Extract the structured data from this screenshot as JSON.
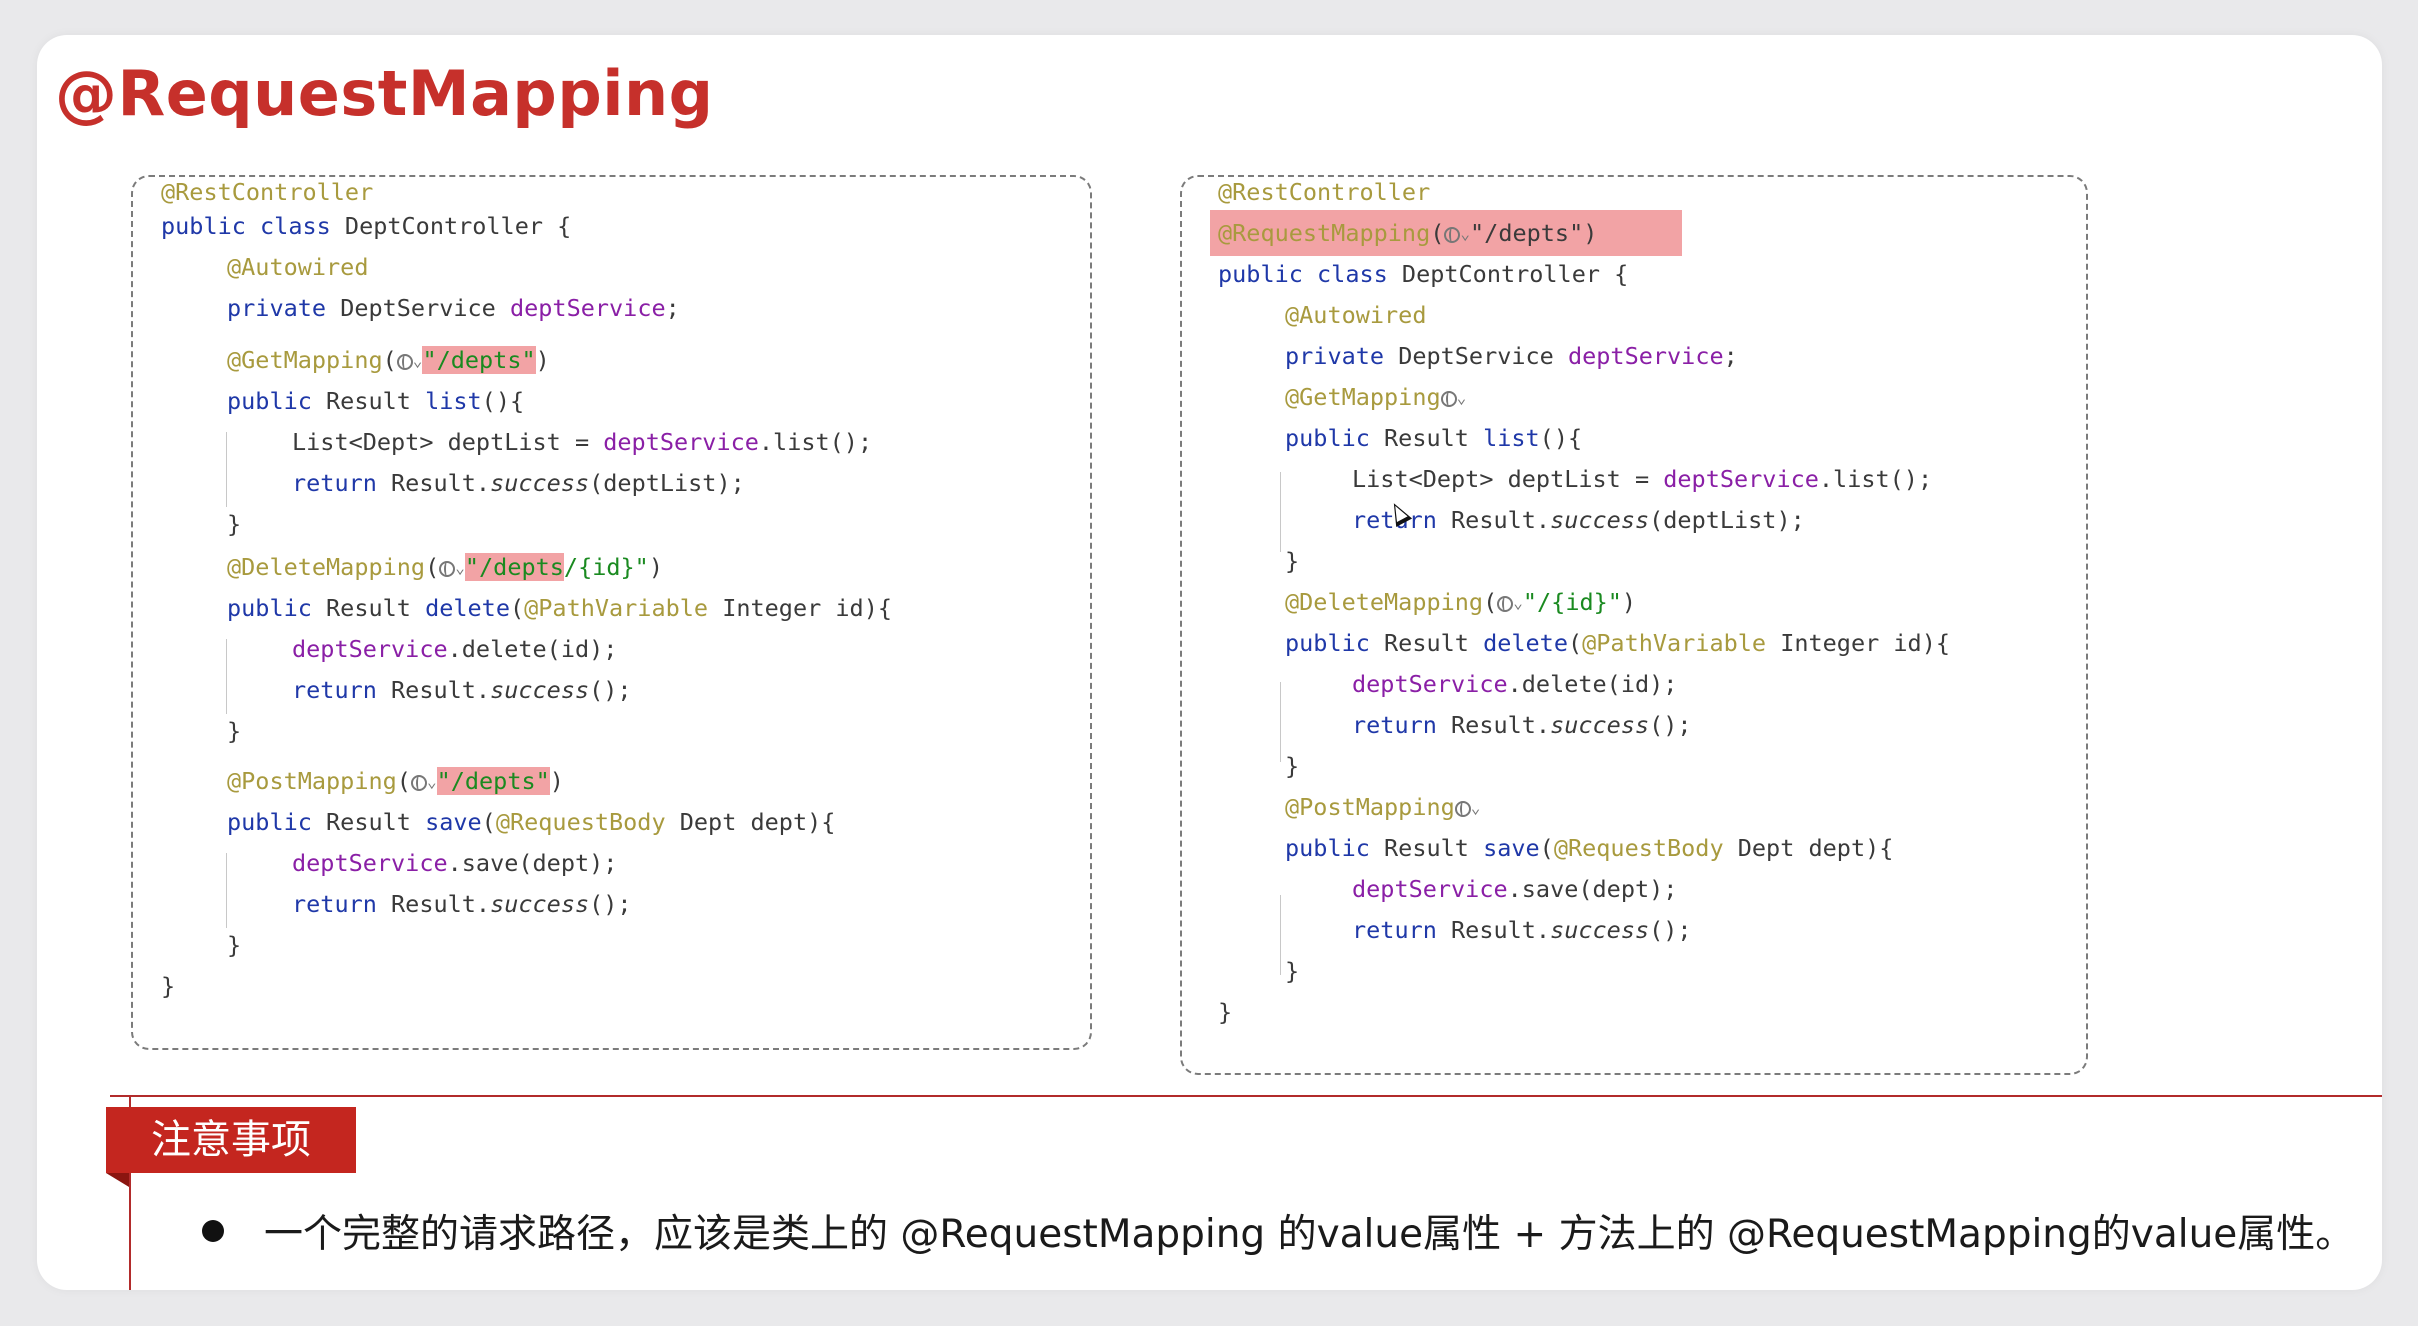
{
  "title": "@RequestMapping",
  "left_code": {
    "lines": {
      "l1_ann": "@RestController",
      "l2_kw": "public class",
      "l2_rest": " DeptController {",
      "l3_ann": "@Autowired",
      "l4_kw": "private",
      "l4_type": " DeptService ",
      "l4_fld": "deptService",
      "l4_end": ";",
      "l5_ann": "@GetMapping",
      "l5_open": "(",
      "l5_str": "\"/depts\"",
      "l5_close": ")",
      "l6_kw": "public",
      "l6_type": " Result ",
      "l6_method": "list",
      "l6_end": "(){",
      "l7_a": "List<Dept> deptList = ",
      "l7_fld": "deptService",
      "l7_b": ".list();",
      "l8_kw": "return",
      "l8_a": " Result.",
      "l8_it": "success",
      "l8_b": "(deptList);",
      "l9": "}",
      "l10_ann": "@DeleteMapping",
      "l10_open": "(",
      "l10_str_hl": "\"/depts",
      "l10_str_rest": "/{id}\"",
      "l10_close": ")",
      "l11_kw": "public",
      "l11_type": " Result ",
      "l11_method": "delete",
      "l11_open": "(",
      "l11_ann": "@PathVariable",
      "l11_rest": " Integer id){",
      "l12_fld": "deptService",
      "l12_rest": ".delete(id);",
      "l13_kw": "return",
      "l13_a": " Result.",
      "l13_it": "success",
      "l13_b": "();",
      "l14": "}",
      "l15_ann": "@PostMapping",
      "l15_open": "(",
      "l15_str": "\"/depts\"",
      "l15_close": ")",
      "l16_kw": "public",
      "l16_type": " Result ",
      "l16_method": "save",
      "l16_open": "(",
      "l16_ann": "@RequestBody",
      "l16_rest": " Dept dept){",
      "l17_fld": "deptService",
      "l17_rest": ".save(dept);",
      "l18_kw": "return",
      "l18_a": " Result.",
      "l18_it": "success",
      "l18_b": "();",
      "l19": "}",
      "l20": "}"
    }
  },
  "right_code": {
    "lines": {
      "l1_ann": "@RestController",
      "l2_ann": "@RequestMapping",
      "l2_open": "(",
      "l2_str": "\"/depts\"",
      "l2_close": ")",
      "l3_kw": "public class",
      "l3_rest": " DeptController {",
      "l4_ann": "@Autowired",
      "l5_kw": "private",
      "l5_type": " DeptService ",
      "l5_fld": "deptService",
      "l5_end": ";",
      "l6_ann": "@GetMapping",
      "l7_kw": "public",
      "l7_type": " Result ",
      "l7_method": "list",
      "l7_end": "(){",
      "l8_a": "List<Dept> deptList = ",
      "l8_fld": "deptService",
      "l8_b": ".list();",
      "l9_kw": "return",
      "l9_a": " Result.",
      "l9_it": "success",
      "l9_b": "(deptList);",
      "l10": "}",
      "l11_ann": "@DeleteMapping",
      "l11_open": "(",
      "l11_str": "\"/{id}\"",
      "l11_close": ")",
      "l12_kw": "public",
      "l12_type": " Result ",
      "l12_method": "delete",
      "l12_open": "(",
      "l12_ann": "@PathVariable",
      "l12_rest": " Integer id){",
      "l13_fld": "deptService",
      "l13_rest": ".delete(id);",
      "l14_kw": "return",
      "l14_a": " Result.",
      "l14_it": "success",
      "l14_b": "();",
      "l15": "}",
      "l16_ann": "@PostMapping",
      "l17_kw": "public",
      "l17_type": " Result ",
      "l17_method": "save",
      "l17_open": "(",
      "l17_ann": "@RequestBody",
      "l17_rest": " Dept dept){",
      "l18_fld": "deptService",
      "l18_rest": ".save(dept);",
      "l19_kw": "return",
      "l19_a": " Result.",
      "l19_it": "success",
      "l19_b": "();",
      "l20": "}",
      "l21": "}"
    }
  },
  "notice": {
    "tab_label": "注意事项",
    "text": "一个完整的请求路径，应该是类上的 @RequestMapping 的value属性 + 方法上的 @RequestMapping的value属性。"
  },
  "icons": {
    "globe": "globe-icon",
    "chevron": "chevron-down-icon",
    "cursor": "mouse-cursor-icon",
    "bullet": "bullet-icon"
  },
  "colors": {
    "title": "#c6302b",
    "annotation": "#a89a3e",
    "keyword": "#1f38a8",
    "field": "#8a1fa6",
    "string": "#1a8a20",
    "highlight": "#f2a3a5",
    "notice_tab": "#c4261f"
  }
}
